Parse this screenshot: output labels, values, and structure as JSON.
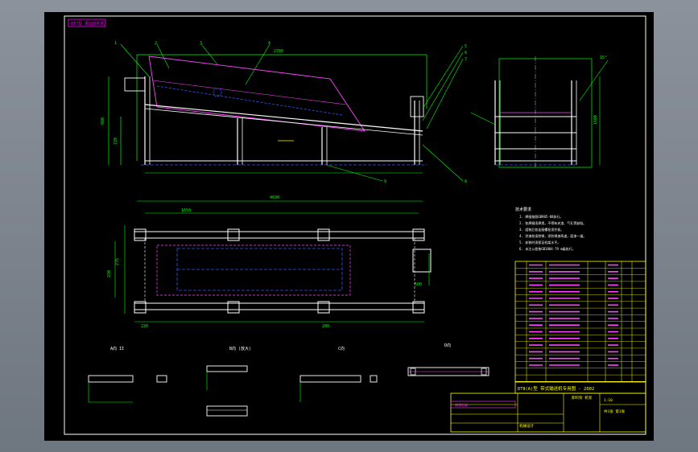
{
  "drawing": {
    "corner_tag": "QT7型 振动给料机",
    "part_labels": [
      "1",
      "2",
      "3",
      "4",
      "5",
      "6",
      "7",
      "8",
      "9"
    ],
    "views": {
      "view_a": "A向 II",
      "view_b": "B向 (放大)",
      "view_c": "C向",
      "view_d": "D向"
    },
    "dims": {
      "length_total": "2780",
      "height_left": "980",
      "height_sub": "720",
      "width_right": "1600",
      "plan_length": "4690",
      "plan_span": "1650",
      "side_1": "500",
      "side_2": "270",
      "side_3": "275",
      "angle": "15°",
      "bottom_1": "230",
      "bottom_2": "200"
    },
    "notes_title": "技术要求",
    "notes": [
      "1. 焊接按照GB985-88执行。",
      "2. 各焊缝须焊透，不得有夹渣、气孔等缺陷。",
      "3. 组装后各连接螺栓须拧紧。",
      "4. 涂漆前须除锈，涂防锈漆两道，面漆一道。",
      "5. 安装时须保证机架水平。",
      "6. 未注公差按GB1804-79 m级执行。"
    ],
    "title_block": {
      "title": "DTⅡ(A)型  带式输送机专用图 - 2002",
      "drawing_name": "卸料架 机架",
      "company": "机械设计",
      "scale": "1:10",
      "sheet": "共1张 第1张"
    },
    "revision_header": "修改记录"
  }
}
